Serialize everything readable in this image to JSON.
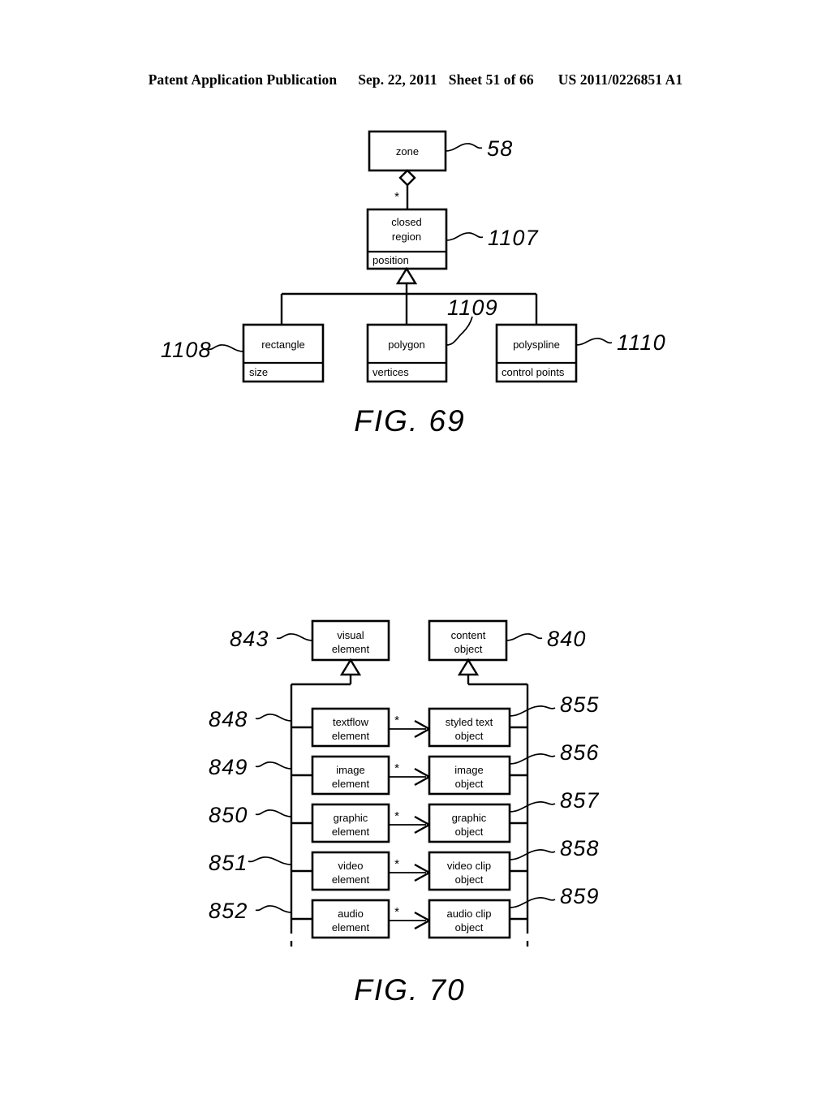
{
  "header": {
    "publication": "Patent Application Publication",
    "date": "Sep. 22, 2011",
    "sheet": "Sheet 51 of 66",
    "patent_number": "US 2011/0226851 A1"
  },
  "figures": [
    {
      "caption": "FIG. 69",
      "type": "uml-class-diagram",
      "classes": [
        {
          "id": "zone",
          "name": "zone",
          "attributes": [],
          "ref": "58"
        },
        {
          "id": "closed-region",
          "name": "closed\nregion",
          "name_line1": "closed",
          "name_line2": "region",
          "attributes": [
            "position"
          ],
          "ref": "1107"
        },
        {
          "id": "rectangle",
          "name": "rectangle",
          "attributes": [
            "size"
          ],
          "ref": "1108"
        },
        {
          "id": "polygon",
          "name": "polygon",
          "attributes": [
            "vertices"
          ],
          "ref": "1109"
        },
        {
          "id": "polyspline",
          "name": "polyspline",
          "attributes": [
            "control points"
          ],
          "ref": "1110"
        }
      ],
      "relationships": [
        {
          "type": "aggregation",
          "from": "zone",
          "to": "closed-region",
          "multiplicity": "*"
        },
        {
          "type": "generalization",
          "from": "rectangle",
          "to": "closed-region"
        },
        {
          "type": "generalization",
          "from": "polygon",
          "to": "closed-region"
        },
        {
          "type": "generalization",
          "from": "polyspline",
          "to": "closed-region"
        }
      ]
    },
    {
      "caption": "FIG. 70",
      "type": "uml-class-diagram",
      "parents": [
        {
          "id": "visual-element",
          "name_line1": "visual",
          "name_line2": "element",
          "ref": "843"
        },
        {
          "id": "content-object",
          "name_line1": "content",
          "name_line2": "object",
          "ref": "840"
        }
      ],
      "rows": [
        {
          "element": {
            "name_line1": "textflow",
            "name_line2": "element",
            "ref": "848"
          },
          "object": {
            "name_line1": "styled text",
            "name_line2": "object",
            "ref": "855"
          },
          "multiplicity": "*"
        },
        {
          "element": {
            "name_line1": "image",
            "name_line2": "element",
            "ref": "849"
          },
          "object": {
            "name_line1": "image",
            "name_line2": "object",
            "ref": "856"
          },
          "multiplicity": "*"
        },
        {
          "element": {
            "name_line1": "graphic",
            "name_line2": "element",
            "ref": "850"
          },
          "object": {
            "name_line1": "graphic",
            "name_line2": "object",
            "ref": "857"
          },
          "multiplicity": "*"
        },
        {
          "element": {
            "name_line1": "video",
            "name_line2": "element",
            "ref": "851"
          },
          "object": {
            "name_line1": "video clip",
            "name_line2": "object",
            "ref": "858"
          },
          "multiplicity": "*"
        },
        {
          "element": {
            "name_line1": "audio",
            "name_line2": "element",
            "ref": "852"
          },
          "object": {
            "name_line1": "audio clip",
            "name_line2": "object",
            "ref": "859"
          },
          "multiplicity": "*"
        }
      ]
    }
  ]
}
